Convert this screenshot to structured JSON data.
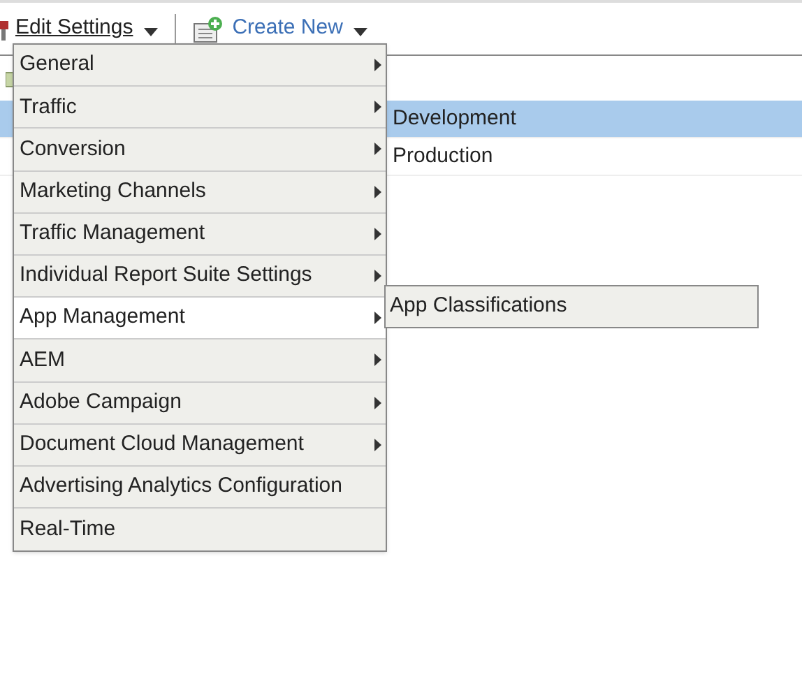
{
  "toolbar": {
    "edit_settings": "Edit Settings",
    "create_new": "Create New"
  },
  "rows": [
    {
      "label": "Development",
      "selected": true
    },
    {
      "label": "Production",
      "selected": false
    }
  ],
  "menu": [
    {
      "label": "General",
      "submenu": true,
      "selected": false
    },
    {
      "label": "Traffic",
      "submenu": true,
      "selected": false
    },
    {
      "label": "Conversion",
      "submenu": true,
      "selected": false
    },
    {
      "label": "Marketing Channels",
      "submenu": true,
      "selected": false
    },
    {
      "label": "Traffic Management",
      "submenu": true,
      "selected": false
    },
    {
      "label": "Individual Report Suite Settings",
      "submenu": true,
      "selected": false
    },
    {
      "label": "App Management",
      "submenu": true,
      "selected": true
    },
    {
      "label": "AEM",
      "submenu": true,
      "selected": false
    },
    {
      "label": "Adobe Campaign",
      "submenu": true,
      "selected": false
    },
    {
      "label": "Document Cloud Management",
      "submenu": true,
      "selected": false
    },
    {
      "label": "Advertising Analytics Configuration",
      "submenu": false,
      "selected": false
    },
    {
      "label": "Real-Time",
      "submenu": false,
      "selected": false
    }
  ],
  "submenu": [
    {
      "label": "App Classifications"
    }
  ]
}
